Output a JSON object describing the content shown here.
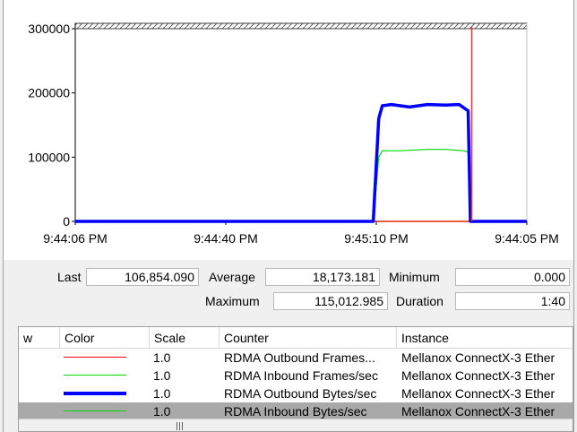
{
  "graph": {
    "y_ticks": [
      "300000",
      "200000",
      "100000",
      "0"
    ],
    "x_ticks": [
      "9:44:06 PM",
      "9:44:40 PM",
      "9:45:10 PM",
      "9:44:05 PM"
    ],
    "cursor_color": "#d64040",
    "plot_background": "#ffffff"
  },
  "chart_data": {
    "type": "line",
    "ylim": [
      0,
      300000
    ],
    "series": [
      {
        "name": "RDMA Outbound Frames...",
        "color": "#ff0000",
        "points": [
          [
            0,
            0
          ],
          [
            0.66,
            0
          ],
          [
            0.67,
            0
          ],
          [
            0.95,
            0
          ],
          [
            0.96,
            0
          ],
          [
            1.0,
            0
          ]
        ]
      },
      {
        "name": "RDMA Inbound Frames/sec",
        "color": "#00d800",
        "points": [
          [
            0,
            0
          ],
          [
            0.66,
            0
          ],
          [
            0.672,
            100000
          ],
          [
            0.68,
            110000
          ],
          [
            0.72,
            110000
          ],
          [
            0.78,
            112000
          ],
          [
            0.82,
            112000
          ],
          [
            0.86,
            110000
          ],
          [
            0.87,
            108000
          ],
          [
            0.875,
            0
          ],
          [
            1.0,
            0
          ]
        ]
      },
      {
        "name": "RDMA Outbound Bytes/sec",
        "color": "#0000ff",
        "points": [
          [
            0,
            0
          ],
          [
            0.66,
            0
          ],
          [
            0.672,
            160000
          ],
          [
            0.68,
            180000
          ],
          [
            0.7,
            182000
          ],
          [
            0.74,
            178000
          ],
          [
            0.78,
            182000
          ],
          [
            0.82,
            181000
          ],
          [
            0.85,
            182000
          ],
          [
            0.87,
            172000
          ],
          [
            0.875,
            0
          ],
          [
            1.0,
            0
          ]
        ]
      },
      {
        "name": "RDMA Inbound Bytes/sec",
        "color": "#00d800",
        "points": [
          [
            0,
            0
          ],
          [
            1.0,
            0
          ]
        ]
      }
    ]
  },
  "stats": {
    "last_label": "Last",
    "last_value": "106,854.090",
    "average_label": "Average",
    "average_value": "18,173.181",
    "minimum_label": "Minimum",
    "minimum_value": "0.000",
    "maximum_label": "Maximum",
    "maximum_value": "115,012.985",
    "duration_label": "Duration",
    "duration_value": "1:40"
  },
  "legend": {
    "columns": [
      "w",
      "Color",
      "Scale",
      "Counter",
      "Instance"
    ],
    "rows": [
      {
        "scale": "1.0",
        "counter": "RDMA Outbound Frames...",
        "instance": "Mellanox ConnectX-3 Ether",
        "color": "#ff0000",
        "thick": false,
        "selected": false
      },
      {
        "scale": "1.0",
        "counter": "RDMA Inbound Frames/sec",
        "instance": "Mellanox ConnectX-3 Ether",
        "color": "#00d800",
        "thick": false,
        "selected": false
      },
      {
        "scale": "1.0",
        "counter": "RDMA Outbound Bytes/sec",
        "instance": "Mellanox ConnectX-3 Ether",
        "color": "#0000ff",
        "thick": true,
        "selected": false
      },
      {
        "scale": "1.0",
        "counter": "RDMA Inbound Bytes/sec",
        "instance": "Mellanox ConnectX-3 Ether",
        "color": "#00d800",
        "thick": false,
        "selected": true
      }
    ]
  }
}
